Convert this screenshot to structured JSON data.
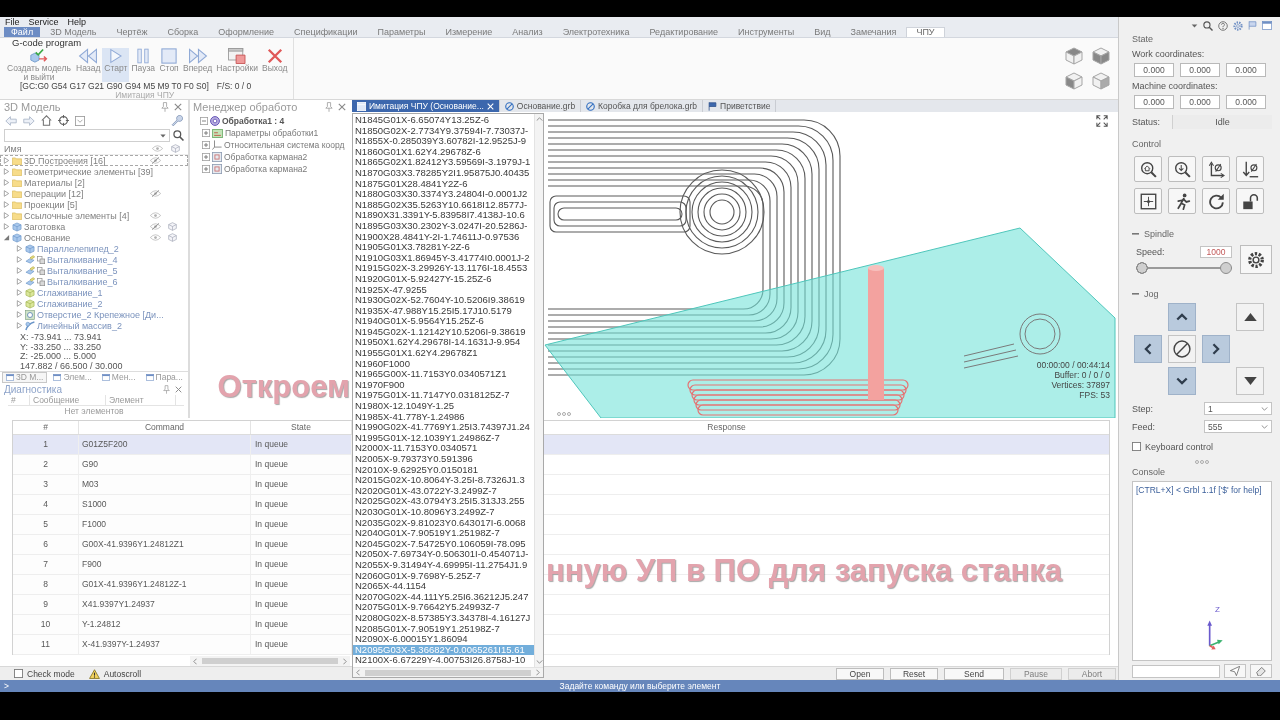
{
  "menu": [
    "File",
    "Service",
    "Help"
  ],
  "ribbon_tabs": {
    "file_button": "Файл",
    "tabs": [
      {
        "label": "3D Модель",
        "selected": false
      },
      {
        "label": "Чертёж",
        "selected": false
      },
      {
        "label": "Сборка",
        "selected": false
      },
      {
        "label": "Оформление",
        "selected": false
      },
      {
        "label": "Спецификации",
        "selected": false
      },
      {
        "label": "Параметры",
        "selected": false
      },
      {
        "label": "Измерение",
        "selected": false
      },
      {
        "label": "Анализ",
        "selected": false
      },
      {
        "label": "Электротехника",
        "selected": false
      },
      {
        "label": "Редактирование",
        "selected": false
      },
      {
        "label": "Инструменты",
        "selected": false
      },
      {
        "label": "Вид",
        "selected": false
      },
      {
        "label": "Замечания",
        "selected": false
      },
      {
        "label": "ЧПУ",
        "selected": true
      }
    ]
  },
  "ribbon": {
    "program_label": "G-code program",
    "buttons": [
      {
        "kind": "create",
        "label": "Создать модель и выйти",
        "selected": false
      },
      {
        "kind": "back",
        "label": "Назад",
        "selected": false
      },
      {
        "kind": "start",
        "label": "Старт",
        "selected": true
      },
      {
        "kind": "pause",
        "label": "Пауза",
        "selected": false
      },
      {
        "kind": "stop",
        "label": "Стоп",
        "selected": false
      },
      {
        "kind": "forward",
        "label": "Вперед",
        "selected": false
      },
      {
        "kind": "settings",
        "label": "Настройки",
        "selected": false
      },
      {
        "kind": "exit",
        "label": "Выход",
        "selected": false
      }
    ],
    "parser_state": "[GC:G0 G54 G17 G21 G90 G94 M5 M9 T0 F0 S0]",
    "feed_speed": "F/S: 0 / 0",
    "group_label": "Имитация ЧПУ"
  },
  "model_panel": {
    "title": "3D Модель",
    "column": "Имя",
    "tree": [
      {
        "label": "3D Построения [16]",
        "kind": "folder",
        "expanded": false,
        "selected": true,
        "visible": false
      },
      {
        "label": "Геометрические элементы [39]",
        "kind": "folder",
        "expanded": false,
        "selected": false
      },
      {
        "label": "Материалы [2]",
        "kind": "folder",
        "expanded": false,
        "selected": false
      },
      {
        "label": "Операции [12]",
        "kind": "folder",
        "expanded": false,
        "selected": false,
        "visible": false
      },
      {
        "label": "Проекции [5]",
        "kind": "folder",
        "expanded": false,
        "selected": false
      },
      {
        "label": "Ссылочные элементы [4]",
        "kind": "folder",
        "expanded": false,
        "selected": false,
        "visible": true
      },
      {
        "label": "Заготовка",
        "kind": "body",
        "expanded": false,
        "selected": false,
        "visible": false,
        "cube": true
      },
      {
        "label": "Основание",
        "kind": "body",
        "expanded": true,
        "selected": false,
        "visible": true,
        "cube": true,
        "children": [
          {
            "label": "Параллелепипед_2",
            "kind": "box",
            "expanded": false,
            "selected": false
          },
          {
            "label": "Выталкивание_4",
            "kind": "extrude",
            "expanded": false,
            "selected": false
          },
          {
            "label": "Выталкивание_5",
            "kind": "extrude",
            "expanded": false,
            "selected": false
          },
          {
            "label": "Выталкивание_6",
            "kind": "extrude",
            "expanded": false,
            "selected": false
          },
          {
            "label": "Сглаживание_1",
            "kind": "fillet",
            "expanded": false,
            "selected": false
          },
          {
            "label": "Сглаживание_2",
            "kind": "fillet",
            "expanded": false,
            "selected": false
          },
          {
            "label": "Отверстие_2 Крепежное [Ди...",
            "kind": "hole",
            "expanded": false,
            "selected": false
          },
          {
            "label": "Линейный массив_2",
            "kind": "array",
            "expanded": false,
            "selected": false
          }
        ]
      }
    ],
    "bounds": [
      "X: -73.941 ... 73.941",
      "Y: -33.250 ... 33.250",
      "Z: -25.000 ... 5.000",
      "147.882 / 66.500 / 30.000"
    ]
  },
  "diagnostics": {
    "tabs": [
      {
        "label": "3D М...",
        "selected": true
      },
      {
        "label": "Элем...",
        "selected": false
      },
      {
        "label": "Мен...",
        "selected": false
      },
      {
        "label": "Пара...",
        "selected": false
      }
    ],
    "title": "Диагностика",
    "columns": [
      "#",
      "Сообщение",
      "Элемент"
    ],
    "empty_text": "Нет элементов"
  },
  "operations_panel": {
    "title": "Менеджер обработо",
    "root": {
      "label": "Обработка1 : 4",
      "expanded": true,
      "selected": false,
      "children": [
        {
          "label": "Параметры обработки1",
          "kind": "parameters",
          "expanded": false,
          "selected": false
        },
        {
          "label": "Относительная система коорд",
          "kind": "coordinates",
          "expanded": false,
          "selected": false
        },
        {
          "label": "Обработка кармана2",
          "kind": "pocket",
          "expanded": false,
          "selected": false
        },
        {
          "label": "Обработка кармана2",
          "kind": "pocket",
          "expanded": false,
          "selected": false
        }
      ]
    }
  },
  "document_tabs": [
    {
      "label": "Имитация ЧПУ (Основание...",
      "kind": "simulation",
      "selected": true
    },
    {
      "label": "Основание.grb",
      "kind": "document",
      "selected": false
    },
    {
      "label": "Коробка для брелока.grb",
      "kind": "document",
      "selected": false
    },
    {
      "label": "Приветствие",
      "kind": "welcome",
      "selected": false
    }
  ],
  "gcode_lines": [
    {
      "text": "N1845G01X-6.65074Y13.25Z-6",
      "selected": false
    },
    {
      "text": "N1850G02X-2.7734Y9.37594I-7.73037J-",
      "selected": false
    },
    {
      "text": "N1855X-0.285039Y3.60782I-12.9525J-9",
      "selected": false
    },
    {
      "text": "N1860G01X1.62Y4.29678Z-6",
      "selected": false
    },
    {
      "text": "N1865G02X1.82412Y3.59569I-3.1979J-1",
      "selected": false
    },
    {
      "text": "N1870G03X3.78285Y2I1.95875J0.40435",
      "selected": false
    },
    {
      "text": "N1875G01X28.4841Y2Z-6",
      "selected": false
    },
    {
      "text": "N1880G03X30.3374Y3.24804I-0.0001J2",
      "selected": false
    },
    {
      "text": "N1885G02X35.5263Y10.6618I12.8577J-",
      "selected": false
    },
    {
      "text": "N1890X31.3391Y-5.83958I7.4138J-10.6",
      "selected": false
    },
    {
      "text": "N1895G03X30.2302Y-3.0247I-20.5286J-",
      "selected": false
    },
    {
      "text": "N1900X28.4841Y-2I-1.74611J-0.97536",
      "selected": false
    },
    {
      "text": "N1905G01X3.78281Y-2Z-6",
      "selected": false
    },
    {
      "text": "N1910G03X1.86945Y-3.41774I0.0001J-2",
      "selected": false
    },
    {
      "text": "N1915G02X-3.29926Y-13.1176I-18.4553",
      "selected": false
    },
    {
      "text": "N1920G01X-5.92427Y-15.25Z-6",
      "selected": false
    },
    {
      "text": "N1925X-47.9255",
      "selected": false
    },
    {
      "text": "N1930G02X-52.7604Y-10.5206I9.38619",
      "selected": false
    },
    {
      "text": "N1935X-47.988Y15.25I5.17J10.5179",
      "selected": false
    },
    {
      "text": "N1940G01X-5.9564Y15.25Z-6",
      "selected": false
    },
    {
      "text": "N1945G02X-1.12142Y10.5206I-9.38619",
      "selected": false
    },
    {
      "text": "N1950X1.62Y4.29678I-14.1631J-9.954",
      "selected": false
    },
    {
      "text": "N1955G01X1.62Y4.29678Z1",
      "selected": false
    },
    {
      "text": "N1960F1000",
      "selected": false
    },
    {
      "text": "N1965G00X-11.7153Y0.0340571Z1",
      "selected": false
    },
    {
      "text": "N1970F900",
      "selected": false
    },
    {
      "text": "N1975G01X-11.7147Y0.0318125Z-7",
      "selected": false
    },
    {
      "text": "N1980X-12.1049Y-1.25",
      "selected": false
    },
    {
      "text": "N1985X-41.778Y-1.24986",
      "selected": false
    },
    {
      "text": "N1990G02X-41.7769Y1.25I3.74397J1.24",
      "selected": false
    },
    {
      "text": "N1995G01X-12.1039Y1.24986Z-7",
      "selected": false
    },
    {
      "text": "N2000X-11.7153Y0.0340571",
      "selected": false
    },
    {
      "text": "N2005X-9.79373Y0.591396",
      "selected": false
    },
    {
      "text": "N2010X-9.62925Y0.0150181",
      "selected": false
    },
    {
      "text": "N2015G02X-10.8064Y-3.25I-8.7326J1.3",
      "selected": false
    },
    {
      "text": "N2020G01X-43.0722Y-3.2499Z-7",
      "selected": false
    },
    {
      "text": "N2025G02X-43.0794Y3.25I5.313J3.255",
      "selected": false
    },
    {
      "text": "N2030G01X-10.8096Y3.2499Z-7",
      "selected": false
    },
    {
      "text": "N2035G02X-9.81023Y0.643017I-6.0068",
      "selected": false
    },
    {
      "text": "N2040G01X-7.90519Y1.25198Z-7",
      "selected": false
    },
    {
      "text": "N2045G02X-7.54725Y0.106059I-78.095",
      "selected": false
    },
    {
      "text": "N2050X-7.69734Y-0.506301I-0.454071J-",
      "selected": false
    },
    {
      "text": "N2055X-9.31494Y-4.69995I-11.2754J1.9",
      "selected": false
    },
    {
      "text": "N2060G01X-9.7698Y-5.25Z-7",
      "selected": false
    },
    {
      "text": "N2065X-44.1154",
      "selected": false
    },
    {
      "text": "N2070G02X-44.111Y5.25I6.36212J5.247",
      "selected": false
    },
    {
      "text": "N2075G01X-9.76642Y5.24993Z-7",
      "selected": false
    },
    {
      "text": "N2080G02X-8.57385Y3.34378I-4.16127J",
      "selected": false
    },
    {
      "text": "N2085G01X-7.90519Y1.25198Z-7",
      "selected": false
    },
    {
      "text": "N2090X-6.00015Y1.86094",
      "selected": false
    },
    {
      "text": "N2095G03X-5.36682Y-0.0065261I15.61",
      "selected": true
    },
    {
      "text": "N2100X-6.67229Y-4.00753I26.8758J-10",
      "selected": false
    }
  ],
  "visualizer": {
    "time": "00:00:00 / 00:44:14",
    "buffer": "Buffer: 0 / 0 / 0",
    "vertices": "Vertices: 37897",
    "fps": "FPS: 53"
  },
  "program_table": {
    "columns": [
      "#",
      "Command",
      "State",
      "Response"
    ],
    "rows": [
      {
        "number": "1",
        "command": "G01Z5F200",
        "state": "In queue",
        "selected": true
      },
      {
        "number": "2",
        "command": "G90",
        "state": "In queue",
        "selected": false
      },
      {
        "number": "3",
        "command": "M03",
        "state": "In queue",
        "selected": false
      },
      {
        "number": "4",
        "command": "S1000",
        "state": "In queue",
        "selected": false
      },
      {
        "number": "5",
        "command": "F1000",
        "state": "In queue",
        "selected": false
      },
      {
        "number": "6",
        "command": "G00X-41.9396Y1.24812Z1",
        "state": "In queue",
        "selected": false
      },
      {
        "number": "7",
        "command": "F900",
        "state": "In queue",
        "selected": false
      },
      {
        "number": "8",
        "command": "G01X-41.9396Y1.24812Z-1",
        "state": "In queue",
        "selected": false
      },
      {
        "number": "9",
        "command": "X41.9397Y1.24937",
        "state": "In queue",
        "selected": false
      },
      {
        "number": "10",
        "command": "Y-1.24812",
        "state": "In queue",
        "selected": false
      },
      {
        "number": "11",
        "command": "X-41.9397Y-1.24937",
        "state": "In queue",
        "selected": false
      }
    ]
  },
  "program_controls": {
    "check_mode": {
      "label": "Check mode",
      "checked": false
    },
    "autoscroll_label": "Autoscroll",
    "buttons": [
      {
        "label": "Open",
        "disabled": false
      },
      {
        "label": "Reset",
        "disabled": false
      },
      {
        "label": "Send",
        "disabled": false
      },
      {
        "label": "Pause",
        "disabled": true
      },
      {
        "label": "Abort",
        "disabled": true
      }
    ]
  },
  "control_panel": {
    "state_title": "State",
    "work_label": "Work coordinates:",
    "work": [
      "0.000",
      "0.000",
      "0.000"
    ],
    "machine_label": "Machine coordinates:",
    "machine": [
      "0.000",
      "0.000",
      "0.000"
    ],
    "status_label": "Status:",
    "status": "Idle",
    "control_title": "Control",
    "spindle": {
      "title": "Spindle",
      "speed_label": "Speed:",
      "speed": "1000",
      "level": 1
    },
    "jog": {
      "title": "Jog",
      "step_label": "Step:",
      "step": "1",
      "feed_label": "Feed:",
      "feed": "555"
    },
    "keyboard_control": {
      "label": "Keyboard control",
      "checked": false
    },
    "console": {
      "title": "Console",
      "text": "[CTRL+X] < Grbl 1.1f ['$' for help]",
      "axis_label": "Z"
    }
  },
  "caption": [
    "Откроем",
    "нную УП в ПО для запуска станка"
  ],
  "status_bar": {
    "prompt": ">",
    "message": "Задайте команду или выберите элемент"
  }
}
